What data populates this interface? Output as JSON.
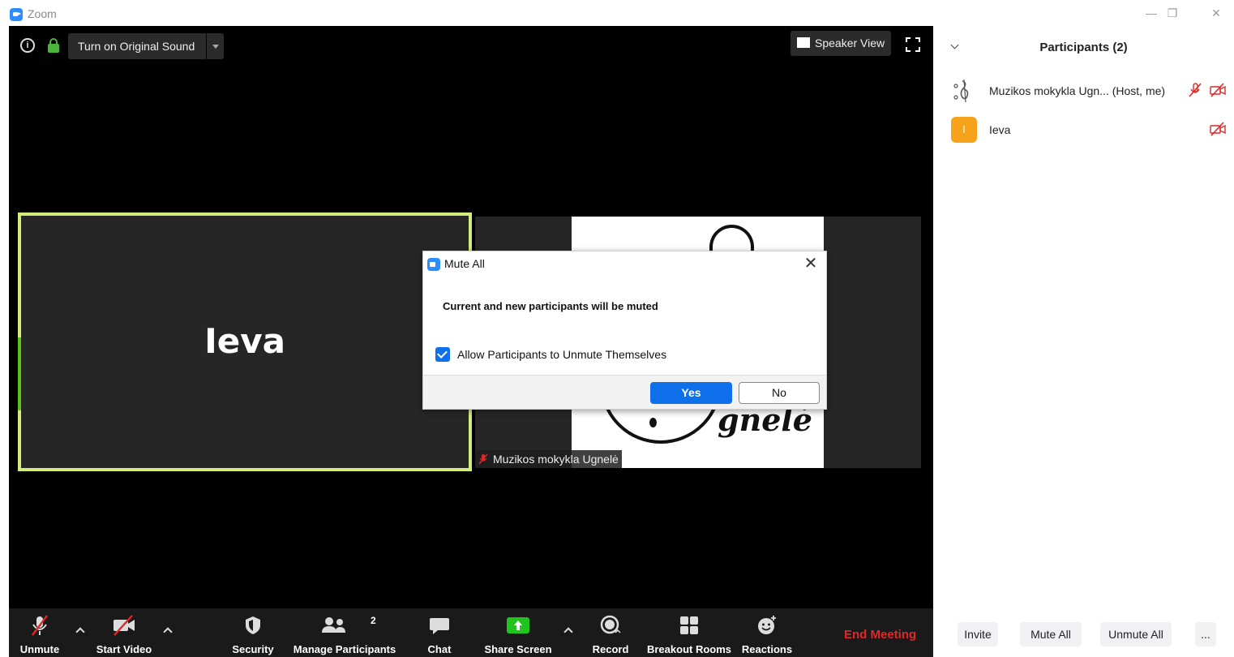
{
  "window": {
    "title": "Zoom"
  },
  "meeting_top": {
    "original_sound_label": "Turn on Original Sound",
    "view_label": "Speaker View"
  },
  "tiles": {
    "active_name": "Ieva",
    "other_name": "Muzikos mokykla Ugnelė",
    "logo_text": "gnelė"
  },
  "dialog": {
    "title": "Mute All",
    "message": "Current and new participants will be muted",
    "checkbox_label": "Allow Participants to Unmute Themselves",
    "checkbox_checked": true,
    "yes_label": "Yes",
    "no_label": "No"
  },
  "toolbar": {
    "unmute": "Unmute",
    "start_video": "Start Video",
    "security": "Security",
    "manage_participants": "Manage Participants",
    "participant_count": "2",
    "chat": "Chat",
    "share_screen": "Share Screen",
    "record": "Record",
    "breakout_rooms": "Breakout Rooms",
    "reactions": "Reactions",
    "end_meeting": "End Meeting"
  },
  "participants_panel": {
    "title": "Participants (2)",
    "items": [
      {
        "name": "Muzikos mokykla Ugn... (Host, me)",
        "avatar_icon": "music-note-icon",
        "muted": true,
        "video_off": true
      },
      {
        "name": "Ieva",
        "avatar_letter": "I",
        "muted": false,
        "video_off": true
      }
    ],
    "buttons": {
      "invite": "Invite",
      "mute_all": "Mute All",
      "unmute_all": "Unmute All",
      "more": "..."
    }
  },
  "colors": {
    "accent": "#0e71eb",
    "zoom_blue": "#2d8cff",
    "end_red": "#e02828",
    "active_border": "#d4ec7a",
    "share_green": "#21c41d",
    "avatar_orange": "#f7a21b",
    "muted_red": "#e02828"
  }
}
